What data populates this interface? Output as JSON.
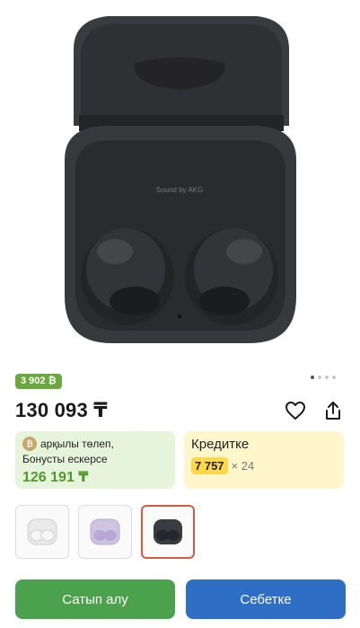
{
  "product": {
    "image_alt": "Samsung Galaxy Buds2 Pro",
    "case_label": "Sound by AKG",
    "carousel_total": 4,
    "carousel_active": 1
  },
  "bonus_badge": "3 902 ₿",
  "price": "130 093 ₸",
  "payment_card": {
    "line1": "арқылы төлеп,",
    "line2": "Бонусты ескерсе",
    "price": "126 191 ₸"
  },
  "credit_card": {
    "title": "Кредитке",
    "amount": "7 757",
    "multiplier": "× 24"
  },
  "color_options": [
    "white",
    "lavender",
    "graphite"
  ],
  "selected_color": "graphite",
  "buttons": {
    "buy": "Сатып алу",
    "cart": "Себетке"
  },
  "colors": {
    "buy": "#4ca24c",
    "cart": "#2f6ec5",
    "bonus": "#6aa83e",
    "selected_border": "#d9593d"
  }
}
